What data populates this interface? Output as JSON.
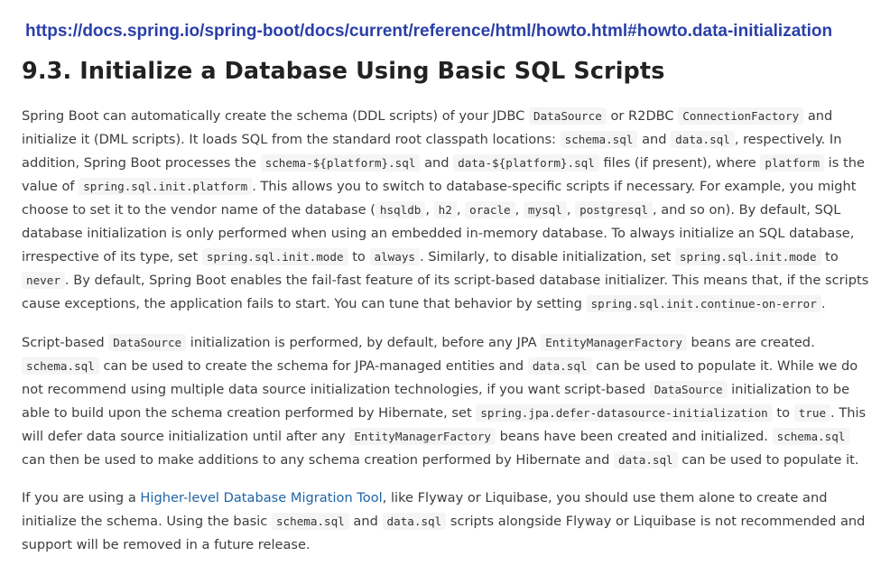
{
  "url": "https://docs.spring.io/spring-boot/docs/current/reference/html/howto.html#howto.data-initialization",
  "heading": "9.3. Initialize a Database Using Basic SQL Scripts",
  "p1": [
    "Spring Boot can automatically create the schema (DDL scripts) of your JDBC ",
    "DataSource",
    " or R2DBC ",
    "ConnectionFactory",
    " and initialize it (DML scripts). It loads SQL from the standard root classpath locations: ",
    "schema.sql",
    " and ",
    "data.sql",
    ", respectively. In addition, Spring Boot processes the ",
    "schema-${platform}.sql",
    " and ",
    "data-${platform}.sql",
    " files (if present), where ",
    "platform",
    " is the value of ",
    "spring.sql.init.platform",
    ". This allows you to switch to database-specific scripts if necessary. For example, you might choose to set it to the vendor name of the database (",
    "hsqldb",
    ", ",
    "h2",
    ", ",
    "oracle",
    ", ",
    "mysql",
    ", ",
    "postgresql",
    ", and so on). By default, SQL database initialization is only performed when using an embedded in-memory database. To always initialize an SQL database, irrespective of its type, set ",
    "spring.sql.init.mode",
    " to ",
    "always",
    ". Similarly, to disable initialization, set ",
    "spring.sql.init.mode",
    " to ",
    "never",
    ". By default, Spring Boot enables the fail-fast feature of its script-based database initializer. This means that, if the scripts cause exceptions, the application fails to start. You can tune that behavior by setting ",
    "spring.sql.init.continue-on-error",
    "."
  ],
  "p2": [
    "Script-based ",
    "DataSource",
    " initialization is performed, by default, before any JPA ",
    "EntityManagerFactory",
    " beans are created. ",
    "schema.sql",
    " can be used to create the schema for JPA-managed entities and ",
    "data.sql",
    " can be used to populate it. While we do not recommend using multiple data source initialization technologies, if you want script-based ",
    "DataSource",
    " initialization to be able to build upon the schema creation performed by Hibernate, set ",
    "spring.jpa.defer-datasource-initialization",
    " to ",
    "true",
    ". This will defer data source initialization until after any ",
    "EntityManagerFactory",
    " beans have been created and initialized. ",
    "schema.sql",
    " can then be used to make additions to any schema creation performed by Hibernate and ",
    "data.sql",
    " can be used to populate it."
  ],
  "p3": [
    "If you are using a ",
    "Higher-level Database Migration Tool",
    ", like Flyway or Liquibase, you should use them alone to create and initialize the schema. Using the basic ",
    "schema.sql",
    " and ",
    "data.sql",
    " scripts alongside Flyway or Liquibase is not recommended and support will be removed in a future release."
  ]
}
